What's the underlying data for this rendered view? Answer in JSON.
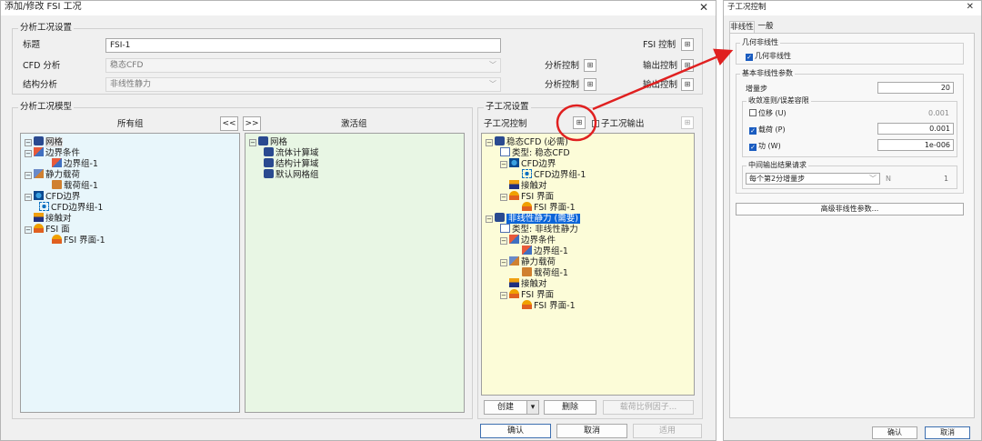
{
  "main": {
    "title": "添加/修改 FSI 工况",
    "close": "✕",
    "settings": {
      "group_label": "分析工况设置",
      "title_label": "标题",
      "title_value": "FSI-1",
      "fsi_ctrl": "FSI 控制",
      "cfd_label": "CFD 分析",
      "cfd_value": "稳态CFD",
      "struct_label": "结构分析",
      "struct_value": "非线性静力",
      "analysis_ctrl": "分析控制",
      "output_ctrl": "输出控制"
    },
    "model": {
      "group_label": "分析工况模型",
      "all_groups": "所有组",
      "btn_left": "<<",
      "btn_right": ">>",
      "active_groups": "激活组",
      "tree": [
        "网格",
        "边界条件",
        "边界组-1",
        "静力载荷",
        "载荷组-1",
        "CFD边界",
        "CFD边界组-1",
        "接触对",
        "FSI 面",
        "FSI 界面-1"
      ],
      "active_tree": [
        "网格",
        "流体计算域",
        "结构计算域",
        "默认网格组"
      ]
    },
    "sub": {
      "group_label": "子工况设置",
      "ctrl": "子工况控制",
      "output": "子工况输出",
      "tree": [
        "稳态CFD (必需)",
        "类型: 稳态CFD",
        "CFD边界",
        "CFD边界组-1",
        "接触对",
        "FSI 界面",
        "FSI 界面-1",
        "非线性静力 (需要)",
        "类型: 非线性静力",
        "边界条件",
        "边界组-1",
        "静力载荷",
        "载荷组-1",
        "接触对",
        "FSI 界面",
        "FSI 界面-1"
      ],
      "create": "创建",
      "delete": "删除",
      "load_factor": "载荷比例因子..."
    },
    "ok": "确认",
    "cancel": "取消",
    "apply": "适用"
  },
  "side": {
    "title": "子工况控制",
    "close": "✕",
    "tabs": [
      "非线性",
      "一般"
    ],
    "geo_group": "几何非线性",
    "geo_cb": "几何非线性",
    "basic_group": "基本非线性参数",
    "inc_label": "增量步",
    "inc_value": "20",
    "conv_group": "收敛准则/误差容限",
    "conv": [
      {
        "label": "位移 (U)",
        "value": "0.001",
        "checked": false
      },
      {
        "label": "载荷 (P)",
        "value": "0.001",
        "checked": true
      },
      {
        "label": "功 (W)",
        "value": "1e-006",
        "checked": true
      }
    ],
    "mid_group": "中间输出结果请求",
    "mid_sel": "每个第2分增量步",
    "mid_n": "N",
    "mid_val": "1",
    "adv_btn": "高级非线性参数...",
    "ok": "确认",
    "cancel": "取消"
  },
  "colors": {
    "annotation": "#e02020",
    "selection": "#0a64d8",
    "active_panel": "#e8f6fb",
    "sub_panel": "#fcfcd8"
  }
}
